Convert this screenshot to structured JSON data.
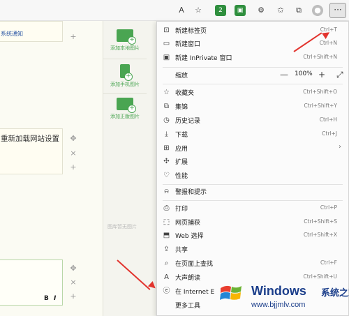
{
  "toolbar": {
    "icons": [
      "read-aloud-icon",
      "favorite-add-icon",
      "extension-icon",
      "extension2-icon",
      "extensions-icon",
      "favorites-icon",
      "collections-icon",
      "profile-icon"
    ],
    "badge_count": "2",
    "more_label": "···"
  },
  "page": {
    "top_note": "系统通知",
    "reload_note": "重新加载网站设置",
    "format_bold": "B",
    "format_italic": "I"
  },
  "image_panel": {
    "add_local": "添加本地图片",
    "add_phone": "添加手机图片",
    "add_doc": "添加正版图片",
    "empty": "图库暂无图片"
  },
  "menu": {
    "new_tab": {
      "label": "新建标签页",
      "shortcut": "Ctrl+T"
    },
    "new_window": {
      "label": "新建窗口",
      "shortcut": "Ctrl+N"
    },
    "new_inprivate": {
      "label": "新建 InPrivate 窗口",
      "shortcut": "Ctrl+Shift+N"
    },
    "zoom": {
      "label": "缩放",
      "minus": "—",
      "value": "100%",
      "plus": "+",
      "fullscreen": "⤢"
    },
    "favorites": {
      "label": "收藏夹",
      "shortcut": "Ctrl+Shift+O"
    },
    "collections": {
      "label": "集锦",
      "shortcut": "Ctrl+Shift+Y"
    },
    "history": {
      "label": "历史记录",
      "shortcut": "Ctrl+H"
    },
    "downloads": {
      "label": "下载",
      "shortcut": "Ctrl+J"
    },
    "apps": {
      "label": "应用"
    },
    "extensions": {
      "label": "扩展"
    },
    "performance": {
      "label": "性能"
    },
    "alerts": {
      "label": "警报和提示"
    },
    "print": {
      "label": "打印",
      "shortcut": "Ctrl+P"
    },
    "web_capture": {
      "label": "网页捕获",
      "shortcut": "Ctrl+Shift+S"
    },
    "web_select": {
      "label": "Web 选择",
      "shortcut": "Ctrl+Shift+X"
    },
    "share": {
      "label": "共享"
    },
    "find": {
      "label": "在页面上查找",
      "shortcut": "Ctrl+F"
    },
    "read_aloud": {
      "label": "大声朗读",
      "shortcut": "Ctrl+Shift+U"
    },
    "ie_mode": {
      "label": "在 Internet E"
    },
    "more_tools": {
      "label": "更多工具"
    }
  },
  "watermark": {
    "brand": "Windows",
    "cn": "系统之家",
    "url": "www.bjjmlv.com"
  },
  "colors": {
    "accent_green": "#4aa552",
    "arrow_red": "#e2342e",
    "watermark_blue": "#1c3f8b"
  }
}
